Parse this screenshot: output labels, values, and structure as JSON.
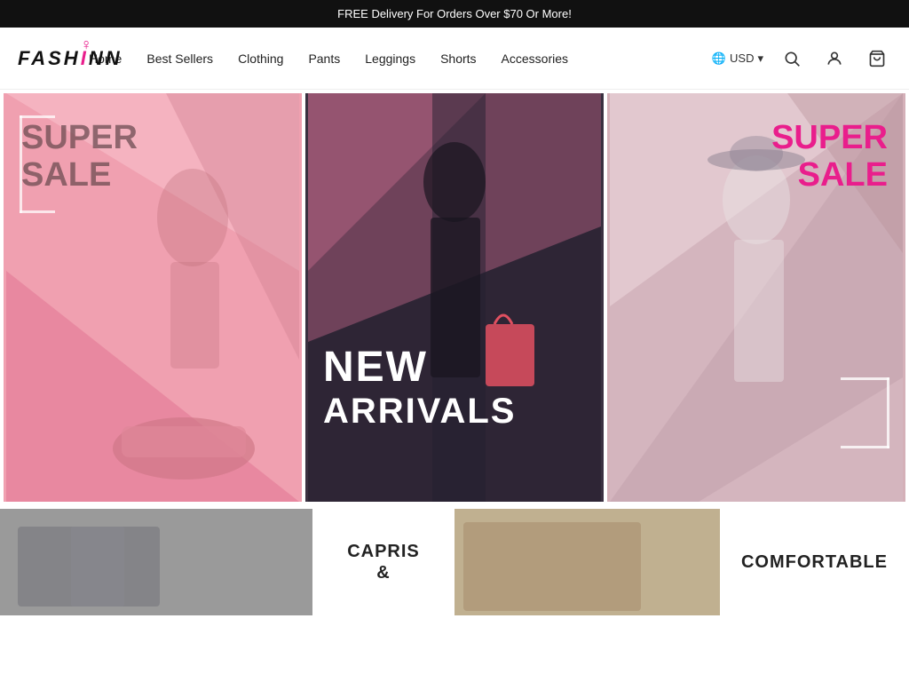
{
  "announcement": {
    "text": "FREE Delivery For Orders Over $70 Or More!"
  },
  "header": {
    "logo_text": "FASHION",
    "nav_items": [
      {
        "label": "Home",
        "id": "home"
      },
      {
        "label": "Best Sellers",
        "id": "best-sellers"
      },
      {
        "label": "Clothing",
        "id": "clothing"
      },
      {
        "label": "Pants",
        "id": "pants"
      },
      {
        "label": "Leggings",
        "id": "leggings"
      },
      {
        "label": "Shorts",
        "id": "shorts"
      },
      {
        "label": "Accessories",
        "id": "accessories"
      }
    ],
    "currency": "USD",
    "currency_icon": "🌐"
  },
  "hero": {
    "panel1": {
      "label1": "SUPER",
      "label2": "SALE"
    },
    "panel2": {
      "label1": "NEW",
      "label2": "ARRIVALS"
    },
    "panel3": {
      "label1": "SUPER",
      "label2": "SALE"
    }
  },
  "bottom": {
    "panel1_label1": "CAPRIS",
    "panel1_label2": "&",
    "panel2_label1": "COMFORTABLE"
  }
}
